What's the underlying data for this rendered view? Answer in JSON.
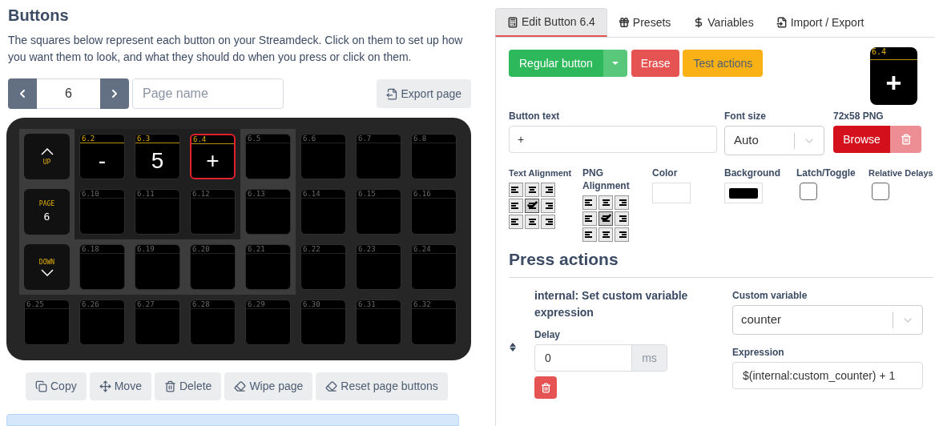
{
  "left": {
    "title": "Buttons",
    "description": "The squares below represent each button on your Streamdeck. Click on them to set up how you want them to look, and what they should do when you press or click on them.",
    "pager": {
      "value": "6",
      "placeholder": "Page name",
      "export": "Export page"
    },
    "grid": [
      {
        "kind": "up",
        "text": "UP"
      },
      {
        "kind": "key",
        "label": "6.2",
        "text": "-",
        "active": true,
        "selected": false
      },
      {
        "kind": "key",
        "label": "6.3",
        "text": "5",
        "active": true,
        "selected": false
      },
      {
        "kind": "key",
        "label": "6.4",
        "text": "+",
        "active": true,
        "selected": true
      },
      {
        "kind": "key",
        "label": "6.5",
        "active": false,
        "selected": false
      },
      {
        "kind": "key",
        "label": "6.6",
        "active": false,
        "selected": false
      },
      {
        "kind": "key",
        "label": "6.7",
        "active": false,
        "selected": false
      },
      {
        "kind": "key",
        "label": "6.8",
        "active": false,
        "selected": false
      },
      {
        "kind": "page",
        "text": "PAGE",
        "value": "6"
      },
      {
        "kind": "key",
        "label": "6.10",
        "active": false,
        "selected": false
      },
      {
        "kind": "key",
        "label": "6.11",
        "active": false,
        "selected": false
      },
      {
        "kind": "key",
        "label": "6.12",
        "active": false,
        "selected": false
      },
      {
        "kind": "key",
        "label": "6.13",
        "active": false,
        "selected": false
      },
      {
        "kind": "key",
        "label": "6.14",
        "active": false,
        "selected": false
      },
      {
        "kind": "key",
        "label": "6.15",
        "active": false,
        "selected": false
      },
      {
        "kind": "key",
        "label": "6.16",
        "active": false,
        "selected": false
      },
      {
        "kind": "down",
        "text": "DOWN"
      },
      {
        "kind": "key",
        "label": "6.18",
        "active": false,
        "selected": false
      },
      {
        "kind": "key",
        "label": "6.19",
        "active": false,
        "selected": false
      },
      {
        "kind": "key",
        "label": "6.20",
        "active": false,
        "selected": false
      },
      {
        "kind": "key",
        "label": "6.21",
        "active": false,
        "selected": false
      },
      {
        "kind": "key",
        "label": "6.22",
        "active": false,
        "selected": false
      },
      {
        "kind": "key",
        "label": "6.23",
        "active": false,
        "selected": false
      },
      {
        "kind": "key",
        "label": "6.24",
        "active": false,
        "selected": false
      },
      {
        "kind": "key",
        "label": "6.25",
        "active": false,
        "selected": false
      },
      {
        "kind": "key",
        "label": "6.26",
        "active": false,
        "selected": false
      },
      {
        "kind": "key",
        "label": "6.27",
        "active": false,
        "selected": false
      },
      {
        "kind": "key",
        "label": "6.28",
        "active": false,
        "selected": false
      },
      {
        "kind": "key",
        "label": "6.29",
        "active": false,
        "selected": false
      },
      {
        "kind": "key",
        "label": "6.30",
        "active": false,
        "selected": false
      },
      {
        "kind": "key",
        "label": "6.31",
        "active": false,
        "selected": false
      },
      {
        "kind": "key",
        "label": "6.32",
        "active": false,
        "selected": false
      }
    ],
    "actions": [
      "Copy",
      "Move",
      "Delete",
      "Wipe page",
      "Reset page buttons"
    ]
  },
  "tabs": [
    {
      "label": "Edit Button 6.4",
      "selected": true
    },
    {
      "label": "Presets",
      "selected": false
    },
    {
      "label": "Variables",
      "selected": false
    },
    {
      "label": "Import / Export",
      "selected": false
    }
  ],
  "editor": {
    "type_button": "Regular button",
    "erase": "Erase",
    "test": "Test actions",
    "preview": {
      "label": "6.4",
      "text": "+"
    },
    "button_text": {
      "label": "Button text",
      "value": "+"
    },
    "font_size": {
      "label": "Font size",
      "value": "Auto"
    },
    "png": {
      "label": "72x58 PNG",
      "browse": "Browse"
    },
    "text_alignment": {
      "label": "Text Alignment",
      "options": [
        {
          "selected": false
        },
        {
          "selected": false
        },
        {
          "selected": false
        },
        {
          "selected": false
        },
        {
          "selected": true
        },
        {
          "selected": false
        },
        {
          "selected": false
        },
        {
          "selected": false
        },
        {
          "selected": false
        }
      ]
    },
    "png_alignment": {
      "label": "PNG Alignment",
      "options": [
        {
          "selected": false
        },
        {
          "selected": false
        },
        {
          "selected": false
        },
        {
          "selected": false
        },
        {
          "selected": true
        },
        {
          "selected": false
        },
        {
          "selected": false
        },
        {
          "selected": false
        },
        {
          "selected": false
        }
      ]
    },
    "color": {
      "label": "Color",
      "color": "#ffffff"
    },
    "background": {
      "label": "Background",
      "color": "#000000"
    },
    "latch": {
      "label": "Latch/Toggle",
      "checked": false
    },
    "relative_delays": {
      "label": "Relative Delays",
      "checked": false
    },
    "press_actions": {
      "title": "Press actions",
      "action": {
        "name": "internal: Set custom variable expression",
        "delay_label": "Delay",
        "delay": "0",
        "unit": "ms",
        "variable_label": "Custom variable",
        "variable": "counter",
        "expression_label": "Expression",
        "expression": "$(internal:custom_counter) + 1"
      }
    }
  }
}
